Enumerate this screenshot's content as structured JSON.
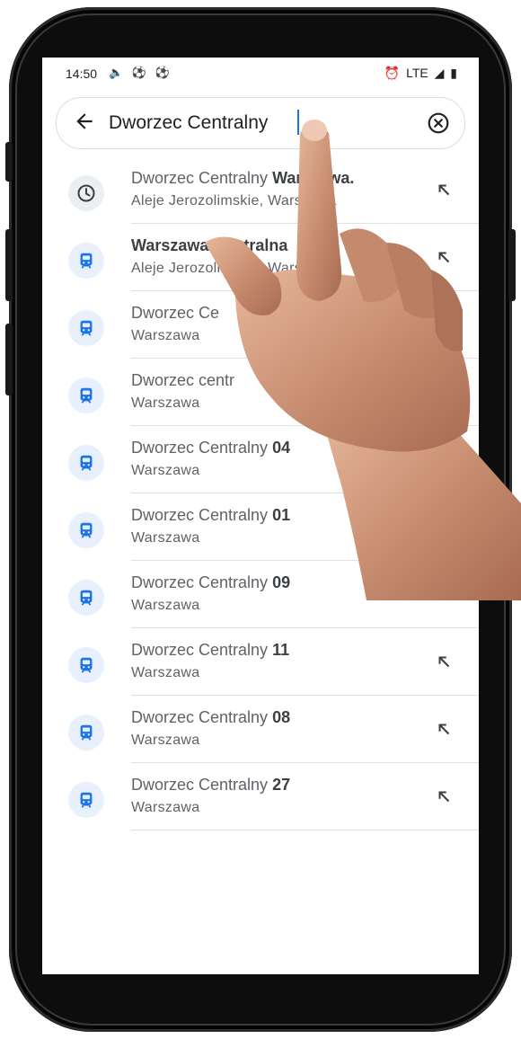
{
  "status_bar": {
    "time": "14:50",
    "left_icons": "🔈 ⚽ ⚽",
    "network": "LTE"
  },
  "search": {
    "value": "Dworzec Centralny"
  },
  "results": [
    {
      "type": "history",
      "title_plain": "Dworzec Centralny ",
      "title_bold": "Warszawa.",
      "subtitle": "Aleje Jerozolimskie, Warszawa"
    },
    {
      "type": "train",
      "title_plain": "",
      "title_bold": "Warszawa Centralna",
      "subtitle": "Aleje Jerozolimskie, Warszawa"
    },
    {
      "type": "train",
      "title_plain": "Dworzec Ce",
      "title_bold": "",
      "subtitle": "Warszawa"
    },
    {
      "type": "train",
      "title_plain": "Dworzec centr",
      "title_bold": "",
      "subtitle": "Warszawa"
    },
    {
      "type": "train",
      "title_plain": "Dworzec Centralny ",
      "title_bold": "04",
      "subtitle": "Warszawa"
    },
    {
      "type": "train",
      "title_plain": "Dworzec Centralny ",
      "title_bold": "01",
      "subtitle": "Warszawa"
    },
    {
      "type": "train",
      "title_plain": "Dworzec Centralny ",
      "title_bold": "09",
      "subtitle": "Warszawa"
    },
    {
      "type": "train",
      "title_plain": "Dworzec Centralny ",
      "title_bold": "11",
      "subtitle": "Warszawa"
    },
    {
      "type": "train",
      "title_plain": "Dworzec Centralny ",
      "title_bold": "08",
      "subtitle": "Warszawa"
    },
    {
      "type": "train",
      "title_plain": "Dworzec Centralny ",
      "title_bold": "27",
      "subtitle": "Warszawa"
    }
  ],
  "colors": {
    "accent": "#1a73e8",
    "train_icon_bg": "#e8f0fe",
    "history_icon_bg": "#eceff1"
  }
}
